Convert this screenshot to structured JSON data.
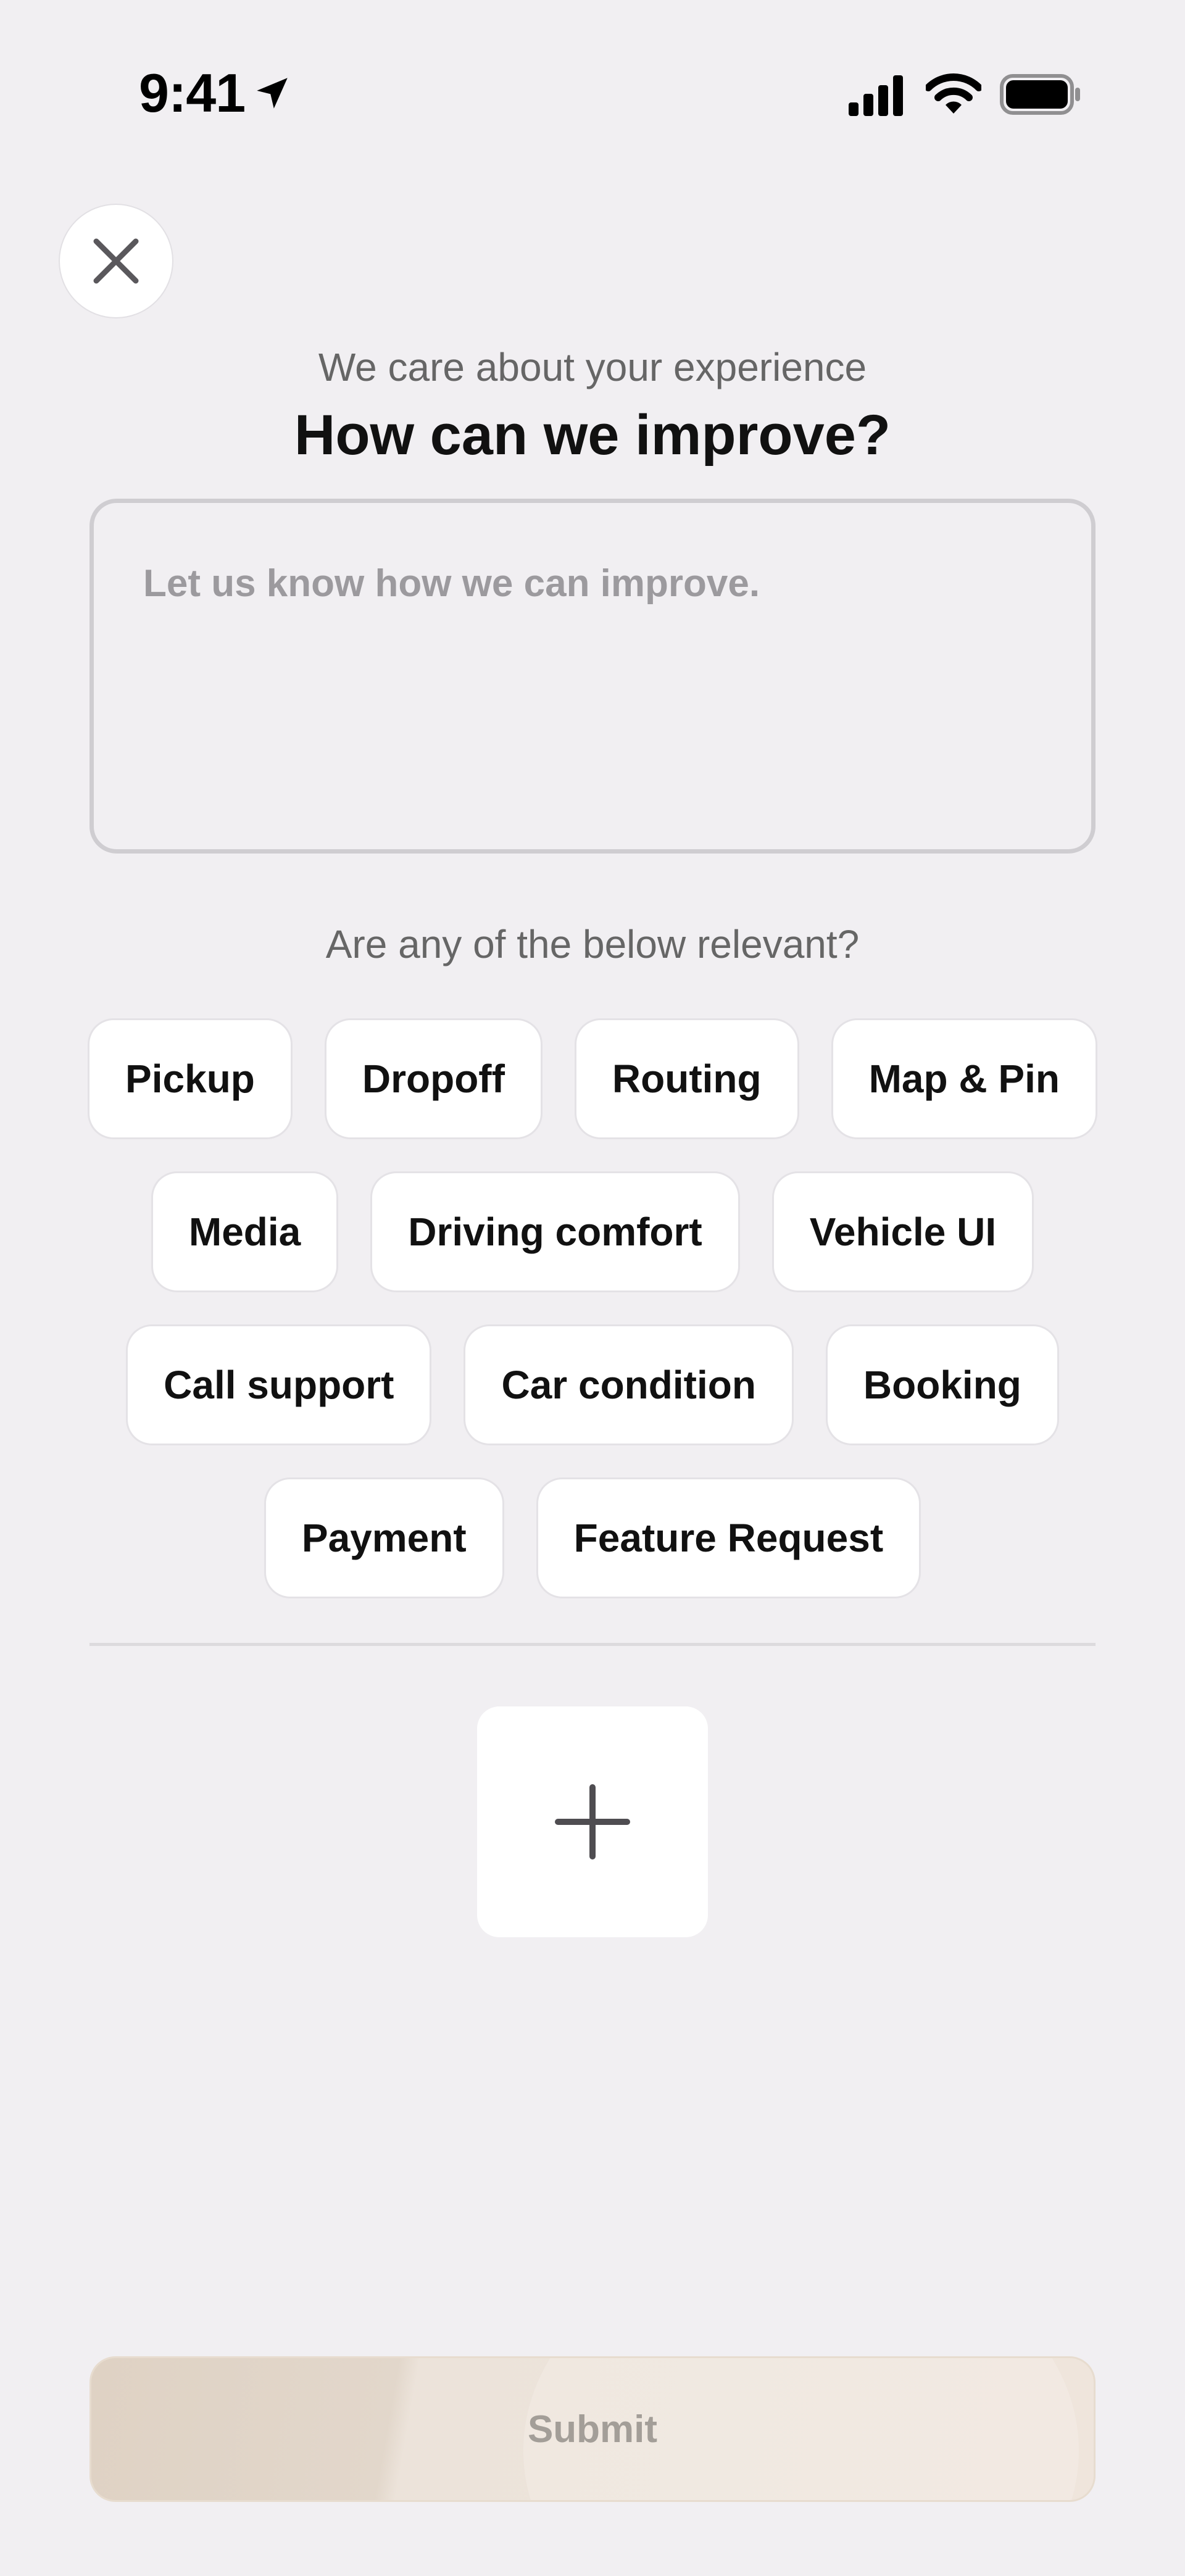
{
  "status_bar": {
    "time": "9:41",
    "icons": [
      "location-arrow-icon",
      "cellular-signal-icon",
      "wifi-icon",
      "battery-icon"
    ]
  },
  "header": {
    "close_icon": "close-icon",
    "subtitle": "We care about your experience",
    "title": "How can we improve?"
  },
  "feedback": {
    "value": "",
    "placeholder": "Let us know how we can improve."
  },
  "topics": {
    "question": "Are any of the below relevant?",
    "rows": [
      [
        "Pickup",
        "Dropoff",
        "Routing",
        "Map & Pin"
      ],
      [
        "Media",
        "Driving comfort",
        "Vehicle UI"
      ],
      [
        "Call support",
        "Car condition",
        "Booking"
      ],
      [
        "Payment",
        "Feature Request"
      ]
    ]
  },
  "attachments": {
    "add_icon": "plus-icon"
  },
  "footer": {
    "submit_label": "Submit",
    "submit_enabled": false
  },
  "colors": {
    "background": "#f1eff2",
    "chip_background": "#ffffff",
    "submit_tint": "#e2d7cb",
    "text_primary": "#111111",
    "text_secondary": "#666666"
  }
}
